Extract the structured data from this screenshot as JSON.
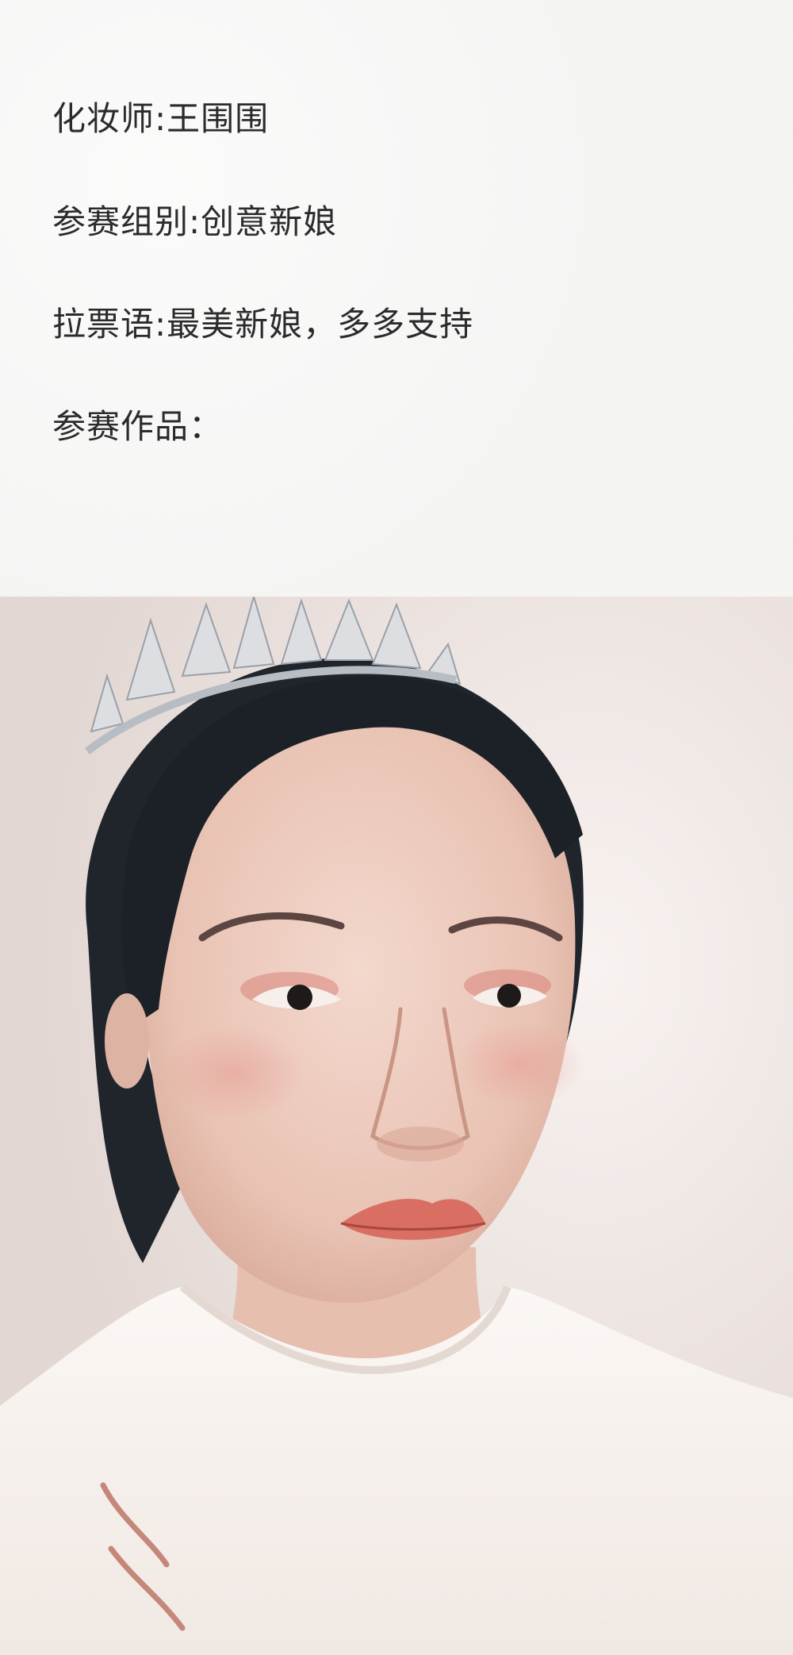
{
  "info": {
    "makeup_artist": "化妆师:王围围",
    "category": "参赛组别:创意新娘",
    "slogan": "拉票语:最美新娘，多多支持",
    "works_label": "参赛作品："
  },
  "colors": {
    "text": "#2b2b2b",
    "panel_bg": "#f6f6f5",
    "photo_wall": "#efe6e3"
  }
}
